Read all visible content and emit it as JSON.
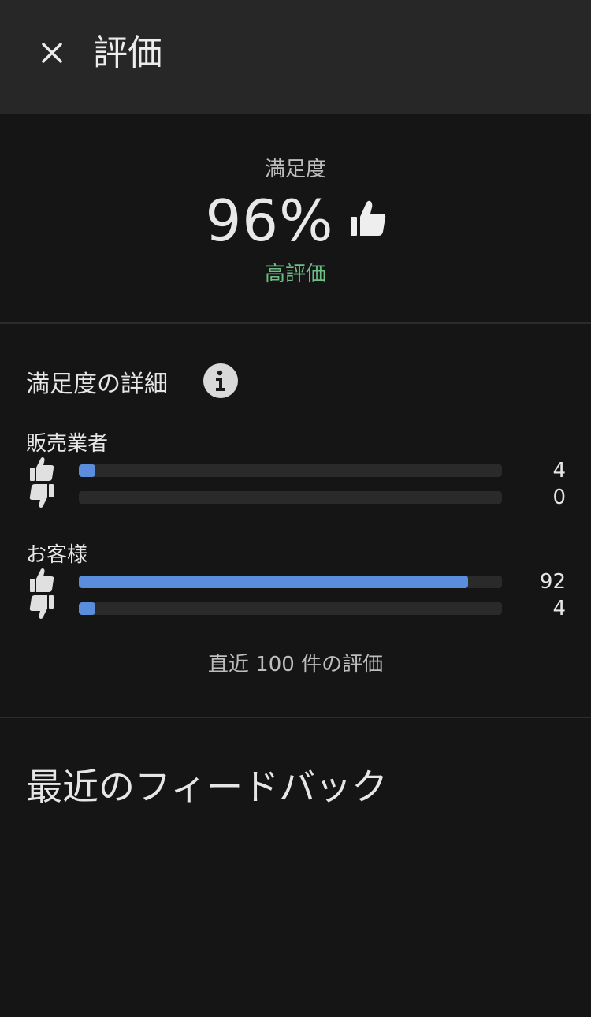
{
  "header": {
    "close_icon": "close-icon",
    "title": "評価"
  },
  "summary": {
    "label": "満足度",
    "percent": "96%",
    "thumb_icon": "thumbs-up-icon",
    "rating_text": "高評価",
    "rating_color": "#6dbf88"
  },
  "details": {
    "title": "満足度の詳細",
    "info_icon": "info-icon",
    "bar_color": "#5b8ddd",
    "groups": [
      {
        "label": "販売業者",
        "rows": [
          {
            "icon": "thumbs-up-icon",
            "count": "4",
            "fill_fraction": 0.04
          },
          {
            "icon": "thumbs-down-icon",
            "count": "0",
            "fill_fraction": 0.0
          }
        ]
      },
      {
        "label": "お客様",
        "rows": [
          {
            "icon": "thumbs-up-icon",
            "count": "92",
            "fill_fraction": 0.92
          },
          {
            "icon": "thumbs-down-icon",
            "count": "4",
            "fill_fraction": 0.04
          }
        ]
      }
    ],
    "footnote": "直近 100 件の評価"
  },
  "feedback": {
    "title": "最近のフィードバック"
  }
}
